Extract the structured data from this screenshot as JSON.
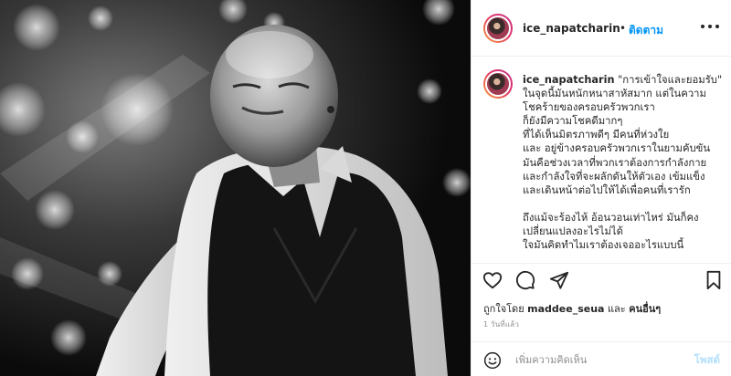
{
  "header": {
    "username": "ice_napatcharin",
    "separator": "•",
    "follow_label": "ติดตาม"
  },
  "caption": {
    "username": "ice_napatcharin",
    "text": "\"การเข้าใจและยอมรับ\"\nในจุดนี้มันหนักหนาสาหัสมาก แต่ในความโชคร้ายของครอบครัวพวกเรา\nก็ยังมีความโชคดีมากๆ\nที่ได้เห็นมิตรภาพดีๆ มีคนที่ห่วงใย\nและ อยู่ข้างครอบครัวพวกเราในยามคับขัน\nมันคือช่วงเวลาที่พวกเราต้องการกำลังกาย\nและกำลังใจที่จะผลักดันให้ตัวเอง เข้มแข็ง\nและเดินหน้าต่อไปให้ได้เพื่อคนที่เรารัก\n\nถึงแม้จะร้องไห้ อ้อนวอนเท่าไหร่ มันก็คง\nเปลี่ยนแปลงอะไรไม่ได้\nใจมันคิดทำไมเราต้องเจออะไรแบบนี้"
  },
  "likes": {
    "prefix": "ถูกใจโดย",
    "liker": "maddee_seua",
    "conjunction": "และ",
    "others": "คนอื่นๆ"
  },
  "timestamp": "1 วันที่แล้ว",
  "comment_box": {
    "placeholder": "เพิ่มความคิดเห็น",
    "post_label": "โพสต์"
  },
  "icons": {
    "like": "heart-icon",
    "comment": "comment-icon",
    "share": "share-icon",
    "save": "bookmark-icon",
    "emoji": "emoji-icon",
    "more": "more-options-icon"
  },
  "colors": {
    "accent": "#0095f6",
    "post_disabled": "#b2dffc",
    "muted": "#8e8e8e",
    "text": "#262626"
  }
}
